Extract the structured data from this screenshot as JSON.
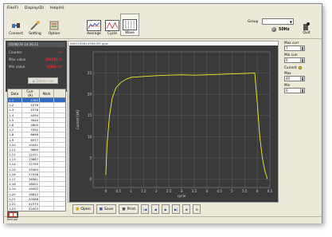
{
  "menu": [
    "File(F)",
    "Display(D)",
    "Help(H)"
  ],
  "toolbar": {
    "connect": "Connect",
    "setting": "Setting",
    "option": "Option",
    "average": "Average",
    "cycle": "Cycle",
    "wave": "Wave",
    "group_label": "Group",
    "frequency": "50Hz",
    "quit": "Quit"
  },
  "left_panel": {
    "timestamp": "05/06/16 14:36:11",
    "rows": [
      {
        "label": "Counter",
        "value": "",
        "unit": "kA"
      },
      {
        "label": "Max value",
        "value": "20(60)",
        "unit": "kA"
      },
      {
        "label": "Min value",
        "value": "1(60)",
        "unit": "kA"
      }
    ],
    "delete_button": "Delete row"
  },
  "table": {
    "headers": [
      [
        "Data",
        ""
      ],
      [
        "Curr.",
        "(A)"
      ],
      [
        "Mark",
        ""
      ]
    ],
    "rows": [
      [
        "1-1",
        "1182",
        ""
      ],
      [
        "1-2",
        "1576",
        ""
      ],
      [
        "1-3",
        "1576",
        ""
      ],
      [
        "1-4",
        "4094",
        ""
      ],
      [
        "1-5",
        "3940",
        ""
      ],
      [
        "1-6",
        "4605",
        ""
      ],
      [
        "1-7",
        "7092",
        ""
      ],
      [
        "1-8",
        "6698",
        ""
      ],
      [
        "1-9",
        "8977",
        ""
      ],
      [
        "1-10",
        "10441",
        ""
      ],
      [
        "1-11",
        "9860",
        ""
      ],
      [
        "1-12",
        "12411",
        ""
      ],
      [
        "1-13",
        "13667",
        ""
      ],
      [
        "1-14",
        "12790",
        ""
      ],
      [
        "1-15",
        "15583",
        ""
      ],
      [
        "1-16",
        "17038",
        ""
      ],
      [
        "1-17",
        "16381",
        ""
      ],
      [
        "1-18",
        "18021",
        ""
      ],
      [
        "1-19",
        "19502",
        ""
      ],
      [
        "1-20",
        "18612",
        ""
      ],
      [
        "1-21",
        "20568",
        ""
      ],
      [
        "1-22",
        "21570",
        ""
      ],
      [
        "1-23",
        "22003",
        ""
      ]
    ]
  },
  "plot": {
    "title": "0605160614360005.ppw",
    "background": "#3a3a3a",
    "trace_color": "#f1ef2a",
    "bottom_buttons": [
      "Open",
      "Save",
      "Print"
    ]
  },
  "chart_data": {
    "type": "line",
    "title": "",
    "xlabel": "cycle",
    "ylabel": "Current [kA]",
    "xlim": [
      -0.5,
      6.5
    ],
    "ylim": [
      -2,
      30
    ],
    "xticks": [
      "0",
      "0.5",
      "1",
      "1.5",
      "2",
      "2.5",
      "3",
      "3.5",
      "4",
      "4.5",
      "5",
      "5.5",
      "6",
      "6.5"
    ],
    "yticks": [
      "0",
      "5",
      "10",
      "15",
      "20",
      "25"
    ],
    "series": [
      {
        "x": [
          0,
          0.05,
          0.15,
          0.25,
          0.4,
          0.6,
          0.8,
          1.0,
          1.5,
          2.0,
          2.5,
          3.0,
          3.5,
          4.0,
          4.5,
          5.0,
          5.5,
          5.9,
          6.0,
          6.1,
          6.2,
          6.3,
          6.4
        ],
        "y": [
          1,
          8,
          15,
          19,
          21.5,
          22.8,
          23.5,
          24,
          24.2,
          24.4,
          24.5,
          24.6,
          24.5,
          24.6,
          24.7,
          24.8,
          24.9,
          25,
          18,
          10,
          5,
          2,
          0
        ]
      }
    ]
  },
  "right_panel": {
    "max_curr_label": "Max curr",
    "max_curr_value": "7",
    "min_curr_label": "Min curr",
    "min_curr_value": "0",
    "current_label": "Current",
    "max_label": "Max",
    "max_value": "40",
    "min_label": "Min",
    "min_value": "0"
  },
  "logo": "Kasuga"
}
